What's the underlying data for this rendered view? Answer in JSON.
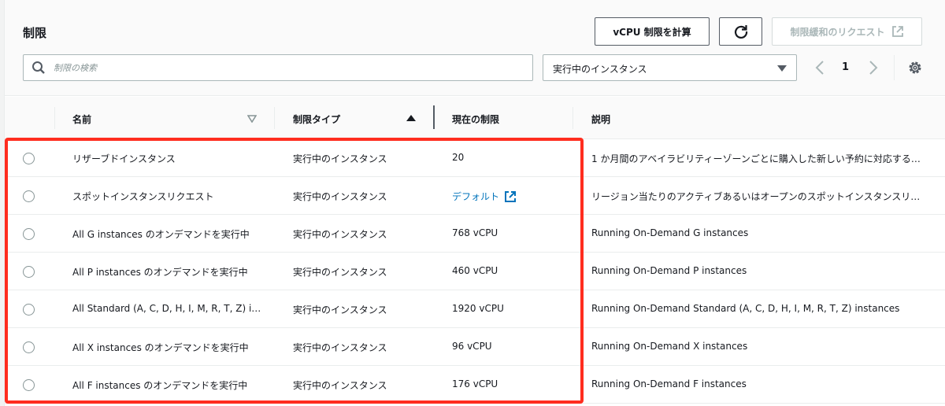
{
  "header": {
    "title": "制限",
    "calc_button": "vCPU 制限を計算",
    "request_button": "制限緩和のリクエスト"
  },
  "search": {
    "placeholder": "制限の検索",
    "value": ""
  },
  "filter": {
    "selected": "実行中のインスタンス"
  },
  "pagination": {
    "page": "1"
  },
  "columns": {
    "name": "名前",
    "type": "制限タイプ",
    "limit": "現在の制限",
    "description": "説明"
  },
  "rows": [
    {
      "name": "リザーブドインスタンス",
      "type": "実行中のインスタンス",
      "limit": "20",
      "description": "1 か月間のアベイラビリティーゾーンごとに購入した新しい予約に対応する…"
    },
    {
      "name": "スポットインスタンスリクエスト",
      "type": "実行中のインスタンス",
      "limit": "デフォルト",
      "limit_is_link": true,
      "description": "リージョン当たりのアクティブあるいはオープンのスポットインスタンスリ…"
    },
    {
      "name": "All G instances のオンデマンドを実行中",
      "type": "実行中のインスタンス",
      "limit": "768 vCPU",
      "description": "Running On-Demand G instances"
    },
    {
      "name": "All P instances のオンデマンドを実行中",
      "type": "実行中のインスタンス",
      "limit": "460 vCPU",
      "description": "Running On-Demand P instances"
    },
    {
      "name": "All Standard (A, C, D, H, I, M, R, T, Z) inst…",
      "type": "実行中のインスタンス",
      "limit": "1920 vCPU",
      "description": "Running On-Demand Standard (A, C, D, H, I, M, R, T, Z) instances"
    },
    {
      "name": "All X instances のオンデマンドを実行中",
      "type": "実行中のインスタンス",
      "limit": "96 vCPU",
      "description": "Running On-Demand X instances"
    },
    {
      "name": "All F instances のオンデマンドを実行中",
      "type": "実行中のインスタンス",
      "limit": "176 vCPU",
      "description": "Running On-Demand F instances"
    }
  ],
  "colors": {
    "link": "#0073bb",
    "highlight": "#ff2d1f",
    "border": "#545b64"
  }
}
